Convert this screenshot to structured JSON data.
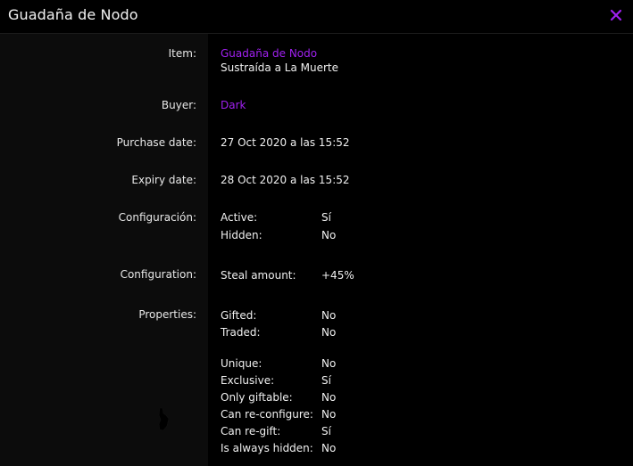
{
  "window": {
    "title": "Guadaña de Nodo",
    "close_icon": "close-icon",
    "accent_color": "#a020f0"
  },
  "item": {
    "label": "Item:",
    "name": "Guadaña de Nodo",
    "description": "Sustraída a La Muerte"
  },
  "buyer": {
    "label": "Buyer:",
    "name": "Dark"
  },
  "purchase_date": {
    "label": "Purchase date:",
    "value": "27 Oct 2020 a las 15:52"
  },
  "expiry_date": {
    "label": "Expiry date:",
    "value": "28 Oct 2020 a las 15:52"
  },
  "configuracion": {
    "label": "Configuración:",
    "rows": [
      {
        "key": "Active:",
        "value": "Sí"
      },
      {
        "key": "Hidden:",
        "value": "No"
      }
    ]
  },
  "configuration": {
    "label": "Configuration:",
    "rows": [
      {
        "key": "Steal amount:",
        "value": "+45%"
      }
    ]
  },
  "properties": {
    "label": "Properties:",
    "group1": [
      {
        "key": "Gifted:",
        "value": "No"
      },
      {
        "key": "Traded:",
        "value": "No"
      }
    ],
    "group2": [
      {
        "key": "Unique:",
        "value": "No"
      },
      {
        "key": "Exclusive:",
        "value": "Sí"
      },
      {
        "key": "Only giftable:",
        "value": "No"
      },
      {
        "key": "Can re-configure:",
        "value": "No"
      },
      {
        "key": "Can re-gift:",
        "value": "Sí"
      },
      {
        "key": "Is always hidden:",
        "value": "No"
      }
    ]
  }
}
